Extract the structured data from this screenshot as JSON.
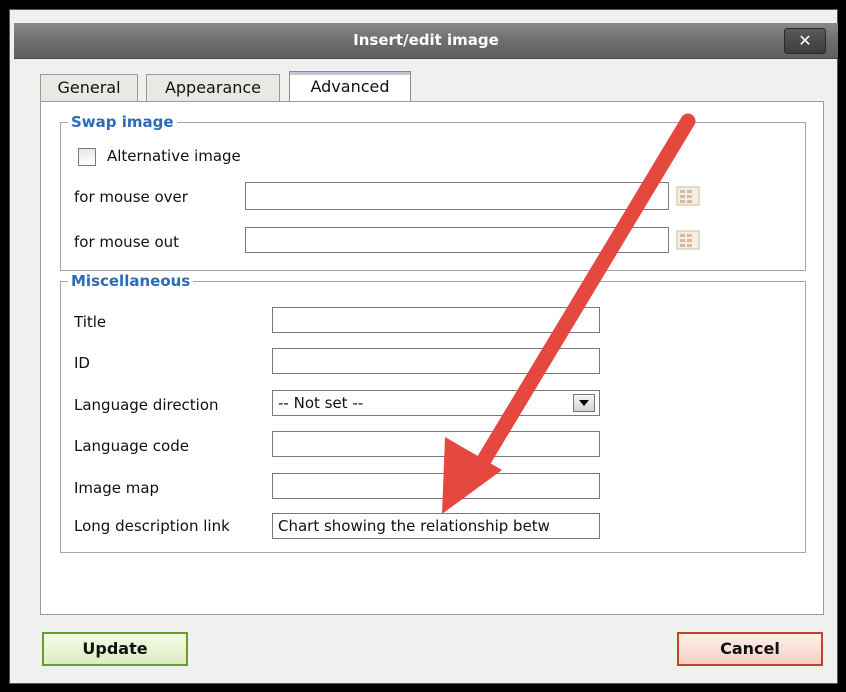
{
  "dialog": {
    "title": "Insert/edit image",
    "close_glyph": "✕"
  },
  "tabs": [
    {
      "label": "General",
      "active": false
    },
    {
      "label": "Appearance",
      "active": false
    },
    {
      "label": "Advanced",
      "active": true
    }
  ],
  "swap_image": {
    "legend": "Swap image",
    "alternative_label": "Alternative image",
    "alternative_checked": false,
    "mouse_over_label": "for mouse over",
    "mouse_over_value": "",
    "mouse_out_label": "for mouse out",
    "mouse_out_value": ""
  },
  "misc": {
    "legend": "Miscellaneous",
    "title_label": "Title",
    "title_value": "",
    "id_label": "ID",
    "id_value": "",
    "lang_dir_label": "Language direction",
    "lang_dir_value": "-- Not set --",
    "lang_code_label": "Language code",
    "lang_code_value": "",
    "image_map_label": "Image map",
    "image_map_value": "",
    "longdesc_label": "Long description link",
    "longdesc_value": "Chart showing the relationship betw"
  },
  "buttons": {
    "update": "Update",
    "cancel": "Cancel"
  },
  "colors": {
    "legend_blue": "#2b6cb8",
    "update_border": "#6d9a2a",
    "cancel_border": "#c2432c",
    "annotation_arrow": "#e5483e"
  },
  "icons": {
    "browse": "browse-icon",
    "close": "close-icon",
    "dropdown": "chevron-down-icon",
    "annotation": "arrow-annotation"
  }
}
